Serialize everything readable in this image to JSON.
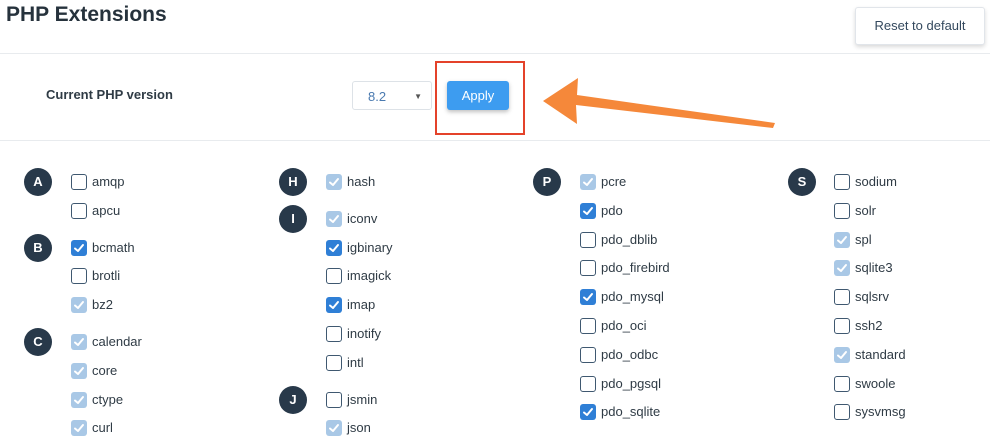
{
  "page": {
    "title": "PHP Extensions",
    "reset_label": "Reset to default"
  },
  "php_version": {
    "label": "Current PHP version",
    "selected": "8.2",
    "apply_label": "Apply"
  },
  "annotation": {
    "arrow_color": "#f5883a",
    "highlight_color": "#e4422a"
  },
  "columns": [
    {
      "groups": [
        {
          "letter": "A",
          "items": [
            {
              "name": "amqp",
              "state": "unchecked"
            },
            {
              "name": "apcu",
              "state": "unchecked"
            }
          ]
        },
        {
          "letter": "B",
          "items": [
            {
              "name": "bcmath",
              "state": "checked"
            },
            {
              "name": "brotli",
              "state": "unchecked"
            },
            {
              "name": "bz2",
              "state": "locked"
            }
          ]
        },
        {
          "letter": "C",
          "items": [
            {
              "name": "calendar",
              "state": "locked"
            },
            {
              "name": "core",
              "state": "locked"
            },
            {
              "name": "ctype",
              "state": "locked"
            },
            {
              "name": "curl",
              "state": "locked"
            }
          ]
        }
      ]
    },
    {
      "groups": [
        {
          "letter": "H",
          "items": [
            {
              "name": "hash",
              "state": "locked"
            }
          ]
        },
        {
          "letter": "I",
          "items": [
            {
              "name": "iconv",
              "state": "locked"
            },
            {
              "name": "igbinary",
              "state": "checked"
            },
            {
              "name": "imagick",
              "state": "unchecked"
            },
            {
              "name": "imap",
              "state": "checked"
            },
            {
              "name": "inotify",
              "state": "unchecked"
            },
            {
              "name": "intl",
              "state": "unchecked"
            }
          ]
        },
        {
          "letter": "J",
          "items": [
            {
              "name": "jsmin",
              "state": "unchecked"
            },
            {
              "name": "json",
              "state": "locked"
            }
          ]
        }
      ]
    },
    {
      "groups": [
        {
          "letter": "P",
          "items": [
            {
              "name": "pcre",
              "state": "locked"
            },
            {
              "name": "pdo",
              "state": "checked"
            },
            {
              "name": "pdo_dblib",
              "state": "unchecked"
            },
            {
              "name": "pdo_firebird",
              "state": "unchecked"
            },
            {
              "name": "pdo_mysql",
              "state": "checked"
            },
            {
              "name": "pdo_oci",
              "state": "unchecked"
            },
            {
              "name": "pdo_odbc",
              "state": "unchecked"
            },
            {
              "name": "pdo_pgsql",
              "state": "unchecked"
            },
            {
              "name": "pdo_sqlite",
              "state": "checked"
            }
          ]
        }
      ]
    },
    {
      "groups": [
        {
          "letter": "S",
          "items": [
            {
              "name": "sodium",
              "state": "unchecked"
            },
            {
              "name": "solr",
              "state": "unchecked"
            },
            {
              "name": "spl",
              "state": "locked"
            },
            {
              "name": "sqlite3",
              "state": "locked"
            },
            {
              "name": "sqlsrv",
              "state": "unchecked"
            },
            {
              "name": "ssh2",
              "state": "unchecked"
            },
            {
              "name": "standard",
              "state": "locked"
            },
            {
              "name": "swoole",
              "state": "unchecked"
            },
            {
              "name": "sysvmsg",
              "state": "unchecked"
            }
          ]
        }
      ]
    }
  ]
}
